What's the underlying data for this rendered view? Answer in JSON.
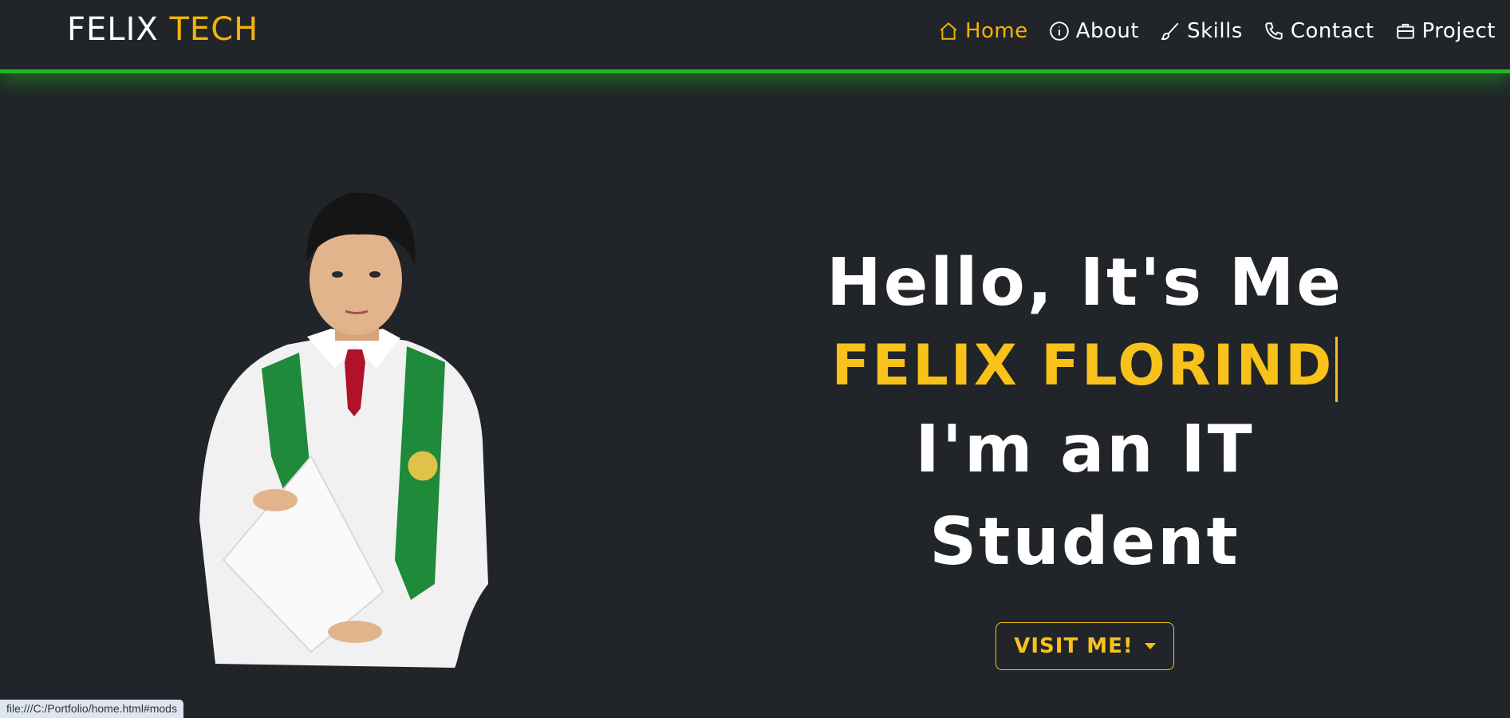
{
  "brand": {
    "part1": "FELIX",
    "part2": "TECH"
  },
  "nav": {
    "items": [
      {
        "label": "Home",
        "icon": "house-icon",
        "active": true
      },
      {
        "label": "About",
        "icon": "info-circle-icon",
        "active": false
      },
      {
        "label": "Skills",
        "icon": "brush-icon",
        "active": false
      },
      {
        "label": "Contact",
        "icon": "phone-icon",
        "active": false
      },
      {
        "label": "Project",
        "icon": "briefcase-icon",
        "active": false
      }
    ]
  },
  "hero": {
    "greeting": "Hello, It's Me",
    "name": "FELIX FLORIND",
    "role": "I'm an IT Student",
    "button_label": "VISIT ME!"
  },
  "status": {
    "url": "file:///C:/Portfolio/home.html#mods"
  },
  "colors": {
    "accent": "#f4b400",
    "glow": "#1eb81e",
    "background": "#212529"
  }
}
